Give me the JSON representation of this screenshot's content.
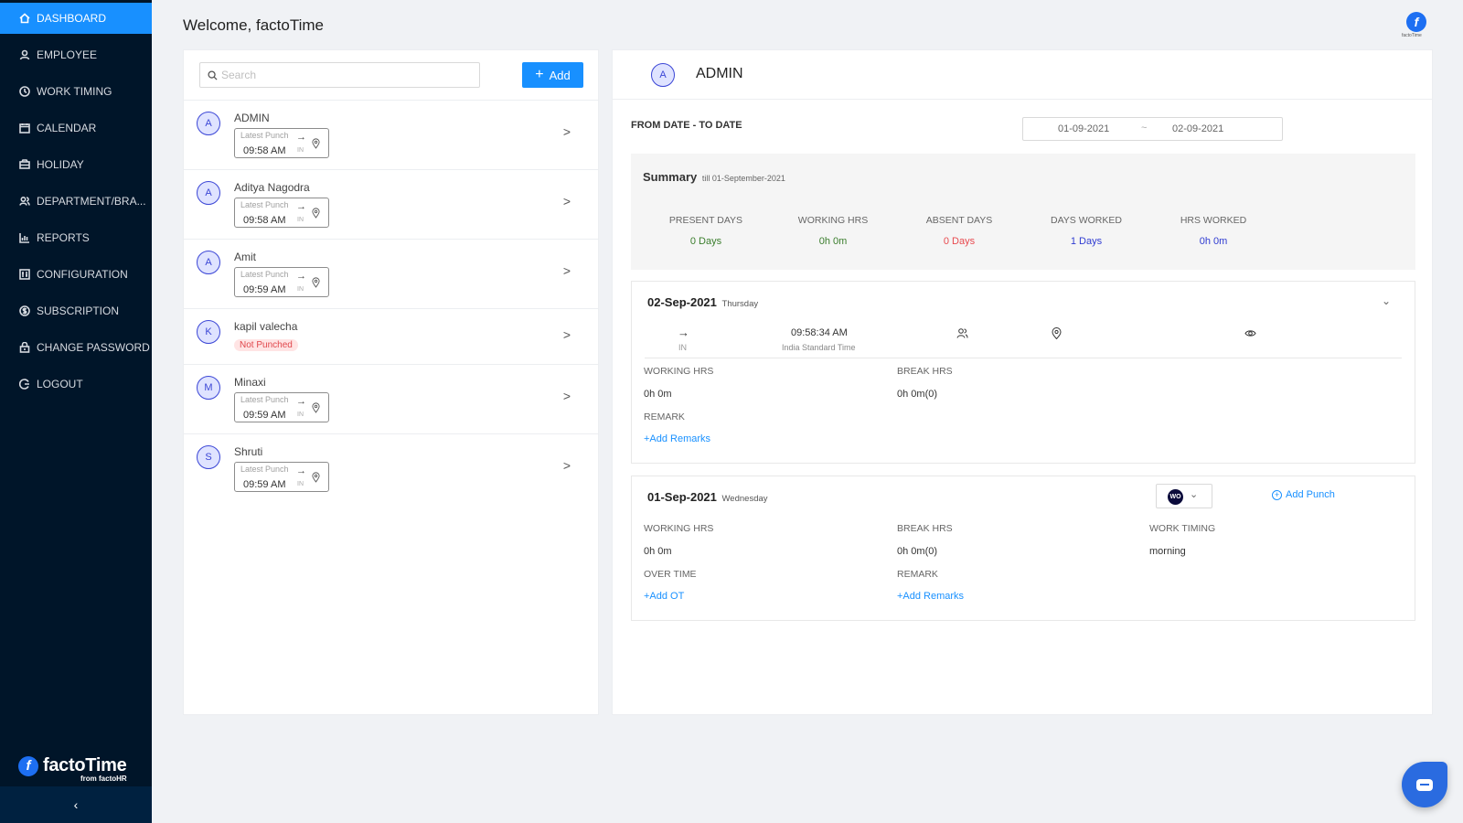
{
  "sidebar": {
    "items": [
      {
        "label": "DASHBOARD",
        "icon": "home-icon",
        "active": true
      },
      {
        "label": "EMPLOYEE",
        "icon": "user-icon"
      },
      {
        "label": "WORK TIMING",
        "icon": "clock-icon"
      },
      {
        "label": "CALENDAR",
        "icon": "calendar-icon"
      },
      {
        "label": "HOLIDAY",
        "icon": "holiday-icon"
      },
      {
        "label": "DEPARTMENT/BRA...",
        "icon": "team-icon"
      },
      {
        "label": "REPORTS",
        "icon": "bar-chart-icon"
      },
      {
        "label": "CONFIGURATION",
        "icon": "config-icon"
      },
      {
        "label": "SUBSCRIPTION",
        "icon": "dollar-icon"
      },
      {
        "label": "CHANGE PASSWORD",
        "icon": "lock-icon"
      },
      {
        "label": "LOGOUT",
        "icon": "logout-icon"
      }
    ],
    "brand": {
      "name": "factoTime",
      "sub": "from factoHR",
      "logo_letter": "f"
    },
    "collapse_icon": "‹"
  },
  "header": {
    "welcome": "Welcome, factoTime",
    "logo_label": "factoTime",
    "logo_letter": "f"
  },
  "employees": {
    "search_placeholder": "Search",
    "search_value": "",
    "add_label": "Add",
    "punch_label": "Latest Punch",
    "in_label": "IN",
    "list": [
      {
        "initial": "A",
        "name": "ADMIN",
        "time": "09:58 AM",
        "punched": true
      },
      {
        "initial": "A",
        "name": "Aditya Nagodra",
        "time": "09:58 AM",
        "punched": true
      },
      {
        "initial": "A",
        "name": "Amit",
        "time": "09:59 AM",
        "punched": true
      },
      {
        "initial": "K",
        "name": "kapil valecha",
        "status": "Not Punched",
        "punched": false
      },
      {
        "initial": "M",
        "name": "Minaxi",
        "time": "09:59 AM",
        "punched": true
      },
      {
        "initial": "S",
        "name": "Shruti",
        "time": "09:59 AM",
        "punched": true
      }
    ]
  },
  "detail": {
    "initial": "A",
    "name": "ADMIN",
    "range_label": "FROM DATE - TO DATE",
    "from_date": "01-09-2021",
    "range_sep": "~",
    "to_date": "02-09-2021",
    "summary": {
      "title": "Summary",
      "subtitle": "till 01-September-2021",
      "stats": [
        {
          "label": "PRESENT DAYS",
          "value": "0 Days",
          "color": "#3a7d2c"
        },
        {
          "label": "WORKING HRS",
          "value": "0h 0m",
          "color": "#3a7d2c"
        },
        {
          "label": "ABSENT DAYS",
          "value": "0 Days",
          "color": "#e84a4f"
        },
        {
          "label": "DAYS WORKED",
          "value": "1 Days",
          "color": "#2f3bd1"
        },
        {
          "label": "HRS WORKED",
          "value": "0h 0m",
          "color": "#2f3bd1"
        }
      ]
    },
    "days": [
      {
        "date": "02-Sep-2021",
        "weekday": "Thursday",
        "punch": {
          "direction": "IN",
          "time": "09:58:34 AM",
          "timezone": "India Standard Time"
        },
        "working_hrs_label": "WORKING HRS",
        "working_hrs": "0h 0m",
        "break_hrs_label": "BREAK HRS",
        "break_hrs": "0h 0m(0)",
        "remark_label": "REMARK",
        "add_remarks": "+Add Remarks"
      },
      {
        "date": "01-Sep-2021",
        "weekday": "Wednesday",
        "status_badge": "WO",
        "add_punch": "Add Punch",
        "working_hrs_label": "WORKING HRS",
        "working_hrs": "0h 0m",
        "break_hrs_label": "BREAK HRS",
        "break_hrs": "0h 0m(0)",
        "work_timing_label": "WORK TIMING",
        "work_timing": "morning",
        "over_time_label": "OVER TIME",
        "add_ot": "+Add OT",
        "remark_label": "REMARK",
        "add_remarks": "+Add Remarks"
      }
    ]
  },
  "colors": {
    "primary": "#1890ff",
    "sidebar_bg": "#001529",
    "danger": "#e84a4f"
  }
}
